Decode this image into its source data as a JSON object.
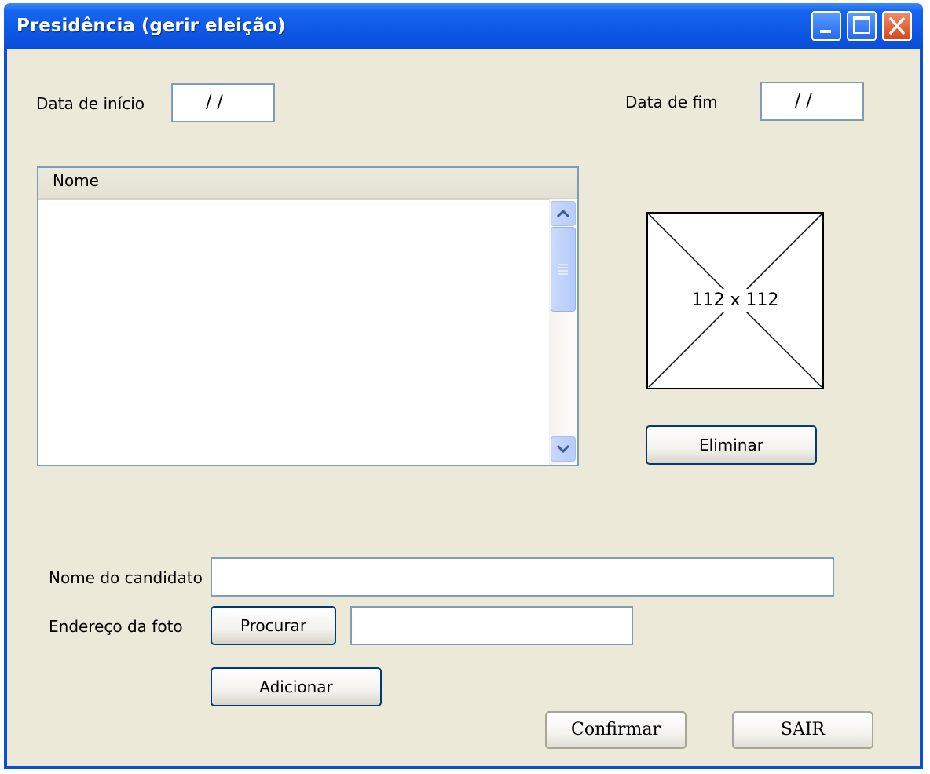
{
  "window": {
    "title": "Presidência (gerir eleição)"
  },
  "dates": {
    "start_label": "Data de início",
    "start_value": "/     /",
    "end_label": "Data de fim",
    "end_value": "/     /"
  },
  "list": {
    "column_header": "Nome",
    "rows": []
  },
  "image_placeholder": {
    "text": "112 x 112"
  },
  "buttons": {
    "delete": "Eliminar",
    "browse": "Procurar",
    "add": "Adicionar",
    "confirm": "Confirmar",
    "exit": "SAIR"
  },
  "form": {
    "candidate_name_label": "Nome do candidato",
    "candidate_name_value": "",
    "photo_address_label": "Endereço da foto",
    "photo_address_value": ""
  },
  "colors": {
    "titlebar": "#0a4fd8",
    "client_bg": "#ece9d8",
    "field_border": "#7f9db9",
    "button_border": "#003c74"
  }
}
